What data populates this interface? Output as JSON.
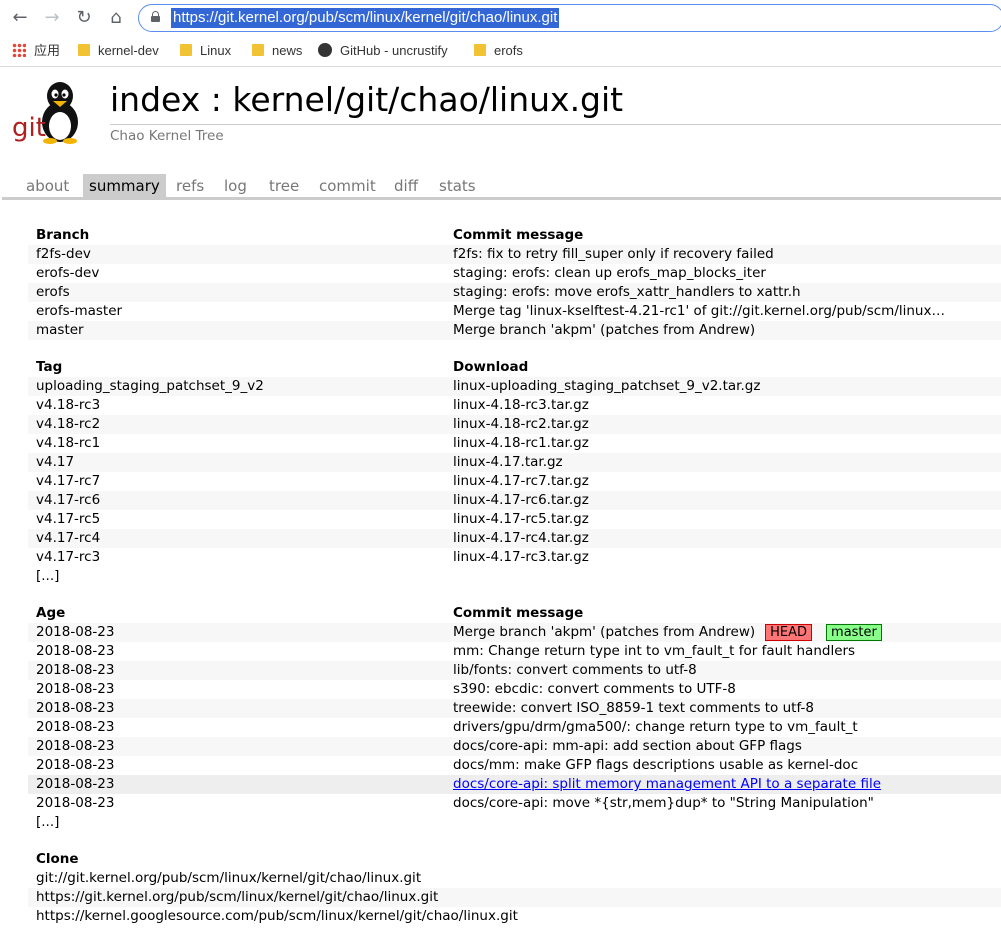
{
  "browser": {
    "url": "https://git.kernel.org/pub/scm/linux/kernel/git/chao/linux.git",
    "bookmarks": [
      {
        "label": "应用",
        "icon": "apps-icon"
      },
      {
        "label": "kernel-dev",
        "icon": "folder-icon"
      },
      {
        "label": "Linux",
        "icon": "folder-icon"
      },
      {
        "label": "news",
        "icon": "folder-icon"
      },
      {
        "label": "GitHub - uncrustify",
        "icon": "github-icon"
      },
      {
        "label": "erofs",
        "icon": "folder-icon"
      }
    ]
  },
  "header": {
    "logo_text": "git",
    "title": "index : kernel/git/chao/linux.git",
    "description": "Chao Kernel Tree"
  },
  "tabs": [
    "about",
    "summary",
    "refs",
    "log",
    "tree",
    "commit",
    "diff",
    "stats"
  ],
  "active_tab": "summary",
  "branches": {
    "header": [
      "Branch",
      "Commit message"
    ],
    "rows": [
      [
        "f2fs-dev",
        "f2fs: fix to retry fill_super only if recovery failed"
      ],
      [
        "erofs-dev",
        "staging: erofs: clean up erofs_map_blocks_iter"
      ],
      [
        "erofs",
        "staging: erofs: move erofs_xattr_handlers to xattr.h"
      ],
      [
        "erofs-master",
        "Merge tag 'linux-kselftest-4.21-rc1' of git://git.kernel.org/pub/scm/linux/ke..."
      ],
      [
        "master",
        "Merge branch 'akpm' (patches from Andrew)"
      ]
    ]
  },
  "tags": {
    "header": [
      "Tag",
      "Download"
    ],
    "rows": [
      [
        "uploading_staging_patchset_9_v2",
        "linux-uploading_staging_patchset_9_v2.tar.gz"
      ],
      [
        "v4.18-rc3",
        "linux-4.18-rc3.tar.gz"
      ],
      [
        "v4.18-rc2",
        "linux-4.18-rc2.tar.gz"
      ],
      [
        "v4.18-rc1",
        "linux-4.18-rc1.tar.gz"
      ],
      [
        "v4.17",
        "linux-4.17.tar.gz"
      ],
      [
        "v4.17-rc7",
        "linux-4.17-rc7.tar.gz"
      ],
      [
        "v4.17-rc6",
        "linux-4.17-rc6.tar.gz"
      ],
      [
        "v4.17-rc5",
        "linux-4.17-rc5.tar.gz"
      ],
      [
        "v4.17-rc4",
        "linux-4.17-rc4.tar.gz"
      ],
      [
        "v4.17-rc3",
        "linux-4.17-rc3.tar.gz"
      ]
    ],
    "more": "[...]"
  },
  "log": {
    "header": [
      "Age",
      "Commit message"
    ],
    "rows": [
      [
        "2018-08-23",
        "Merge branch 'akpm' (patches from Andrew)"
      ],
      [
        "2018-08-23",
        "mm: Change return type int to vm_fault_t for fault handlers"
      ],
      [
        "2018-08-23",
        "lib/fonts: convert comments to utf-8"
      ],
      [
        "2018-08-23",
        "s390: ebcdic: convert comments to UTF-8"
      ],
      [
        "2018-08-23",
        "treewide: convert ISO_8859-1 text comments to utf-8"
      ],
      [
        "2018-08-23",
        "drivers/gpu/drm/gma500/: change return type to vm_fault_t"
      ],
      [
        "2018-08-23",
        "docs/core-api: mm-api: add section about GFP flags"
      ],
      [
        "2018-08-23",
        "docs/mm: make GFP flags descriptions usable as kernel-doc"
      ],
      [
        "2018-08-23",
        "docs/core-api: split memory management API to a separate file"
      ],
      [
        "2018-08-23",
        "docs/core-api: move *{str,mem}dup* to \"String Manipulation\""
      ]
    ],
    "decorations": {
      "head": "HEAD",
      "master": "master"
    },
    "more": "[...]"
  },
  "clone": {
    "header": "Clone",
    "urls": [
      "git://git.kernel.org/pub/scm/linux/kernel/git/chao/linux.git",
      "https://git.kernel.org/pub/scm/linux/kernel/git/chao/linux.git",
      "https://kernel.googlesource.com/pub/scm/linux/kernel/git/chao/linux.git"
    ]
  },
  "colors": {
    "head_deco": "#ff7575",
    "master_deco": "#88ff88",
    "link": "#0000ff",
    "url_highlight": "#3367d6"
  }
}
